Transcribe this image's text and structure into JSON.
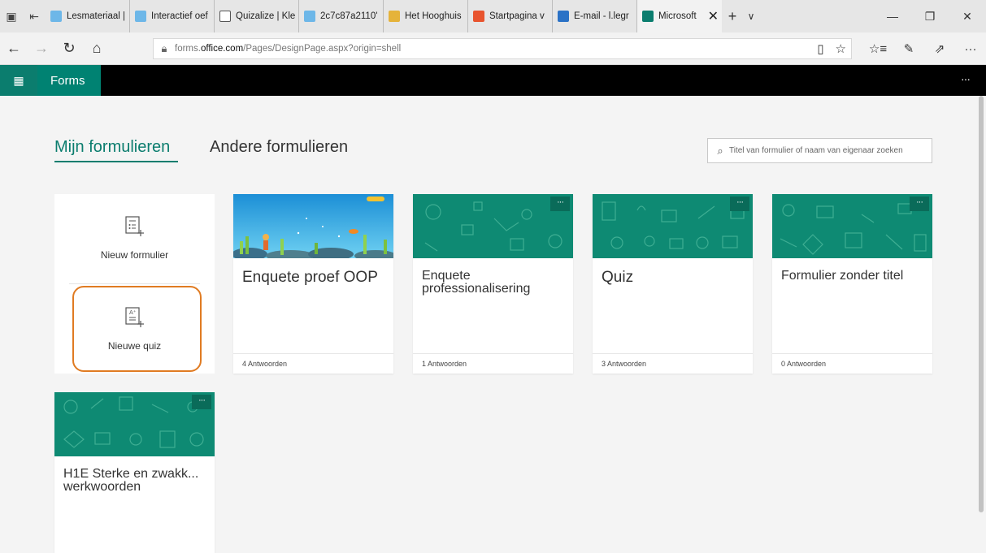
{
  "browser": {
    "tabs": [
      {
        "label": "Lesmateriaal |",
        "icon_color": "#6db7e8"
      },
      {
        "label": "Interactief oef",
        "icon_color": "#6db7e8"
      },
      {
        "label": "Quizalize | Kle",
        "icon_color": "#888888"
      },
      {
        "label": "2c7c87a2110'",
        "icon_color": "#6db7e8"
      },
      {
        "label": "Het Hooghuis",
        "icon_color": "#e5b33a"
      },
      {
        "label": "Startpagina v",
        "icon_color": "#e8542e"
      },
      {
        "label": "E-mail - l.legr",
        "icon_color": "#2b72c6"
      },
      {
        "label": "Microsoft",
        "icon_color": "#0b7d6e"
      }
    ],
    "url_prefix": "forms.",
    "url_domain": "office.com",
    "url_path": "/Pages/DesignPage.aspx?origin=shell"
  },
  "app": {
    "name": "Forms",
    "more": "···"
  },
  "pivots": {
    "mine": "Mijn formulieren",
    "others": "Andere formulieren"
  },
  "search": {
    "placeholder": "Titel van formulier of naam van eigenaar zoeken"
  },
  "create": {
    "new_form": "Nieuw formulier",
    "new_quiz": "Nieuwe quiz"
  },
  "forms": [
    {
      "title": "Enquete proef OOP",
      "responses": "4 Antwoorden"
    },
    {
      "title": "Enquete professionalisering",
      "responses": "1 Antwoorden"
    },
    {
      "title": "Quiz",
      "responses": "3 Antwoorden"
    },
    {
      "title": "Formulier zonder titel",
      "responses": "0 Antwoorden"
    },
    {
      "title": "H1E Sterke en zwakk... werkwoorden",
      "responses": ""
    }
  ],
  "colors": {
    "brand": "#0b7d6e",
    "highlight": "#e07b22"
  }
}
